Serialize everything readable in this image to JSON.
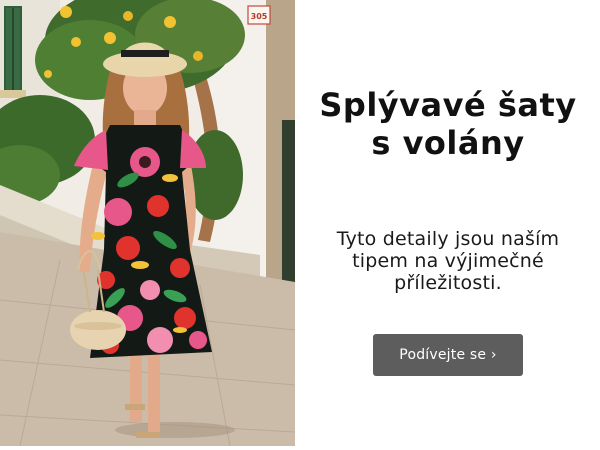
{
  "banner": {
    "headline": {
      "line1": "Splývavé šaty",
      "line2": "s volány"
    },
    "subtext": {
      "line1": "Tyto detaily jsou naším",
      "line2": "tipem na výjimečné",
      "line3": "příležitosti."
    },
    "cta_label": "Podívejte se ›",
    "photo": {
      "wall_sign": "305"
    }
  },
  "colors": {
    "cta_background": "#5d5d5d",
    "cta_text": "#ffffff",
    "headline": "#111111",
    "background": "#ffffff"
  },
  "icons": {
    "cta_arrow": "chevron-right-icon"
  }
}
